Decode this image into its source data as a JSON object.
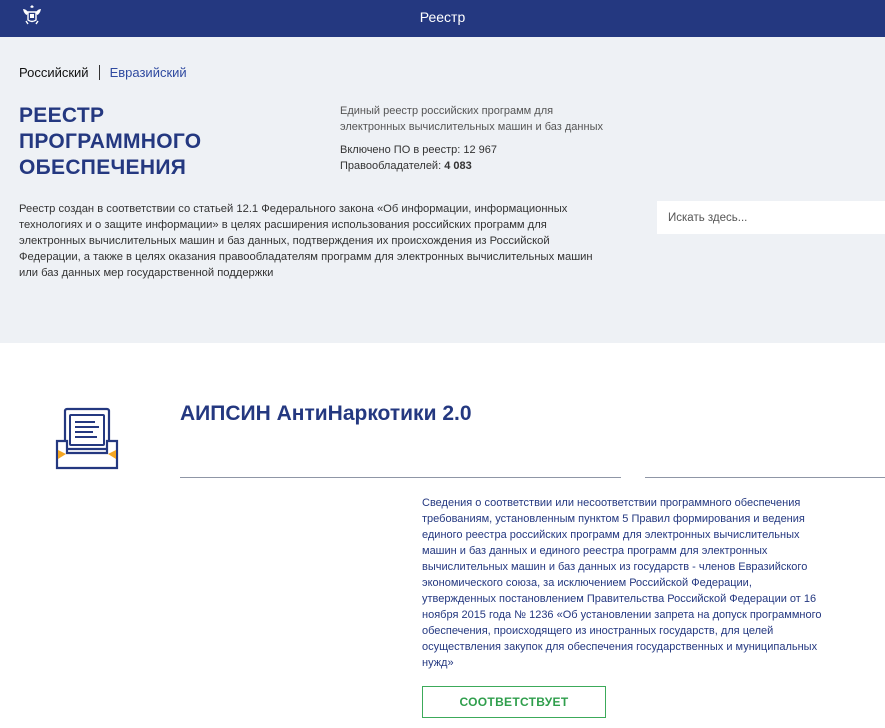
{
  "header": {
    "title": "Реестр",
    "emblem_icon": "coat-of-arms-icon"
  },
  "tabs": [
    {
      "label": "Российский",
      "active": true
    },
    {
      "label": "Евразийский",
      "active": false
    }
  ],
  "hero": {
    "title_lines": [
      "РЕЕСТР",
      "ПРОГРАММНОГО",
      "ОБЕСПЕЧЕНИЯ"
    ],
    "subtitle_lines": [
      "Единый реестр российских программ для",
      "электронных вычислительных машин и баз данных"
    ],
    "included_label": "Включено ПО в реестр:",
    "included_value": "12 967",
    "holders_label": "Правообладателей:",
    "holders_value": "4 083",
    "description_lines": [
      "Реестр создан в соответствии со статьей 12.1 Федерального закона «Об информации, информационных",
      "технологиях и о защите информации» в целях расширения использования российских программ для",
      "электронных вычислительных машин и баз данных, подтверждения их происхождения из Российской",
      "Федерации, а также в целях оказания правообладателям программ для электронных вычислительных машин",
      "или баз данных мер государственной поддержки"
    ]
  },
  "search": {
    "placeholder": "Искать здесь..."
  },
  "product": {
    "icon": "document-tray-icon",
    "title": "АИПСИН АнтиНаркотики 2.0",
    "compliance_lines": [
      "Сведения о соответствии или несоответствии программного обеспечения",
      "требованиям, установленным пунктом 5 Правил формирования и ведения",
      "единого реестра российских программ для электронных вычислительных",
      "машин и баз данных и единого реестра программ для электронных",
      "вычислительных машин и баз данных из государств - членов Евразийского",
      "экономического союза, за исключением Российской Федерации,",
      "утвержденных постановлением Правительства Российской Федерации от 16",
      "ноября 2015 года № 1236 «Об установлении запрета на допуск программного",
      "обеспечения, происходящего из иностранных государств, для целей",
      "осуществления закупок для обеспечения государственных и муниципальных",
      "нужд»"
    ],
    "status": "СООТВЕТСТВУЕТ"
  },
  "colors": {
    "navy": "#243880",
    "background": "#eef1f5",
    "success": "#3caa5a",
    "accent": "#f4a623"
  }
}
